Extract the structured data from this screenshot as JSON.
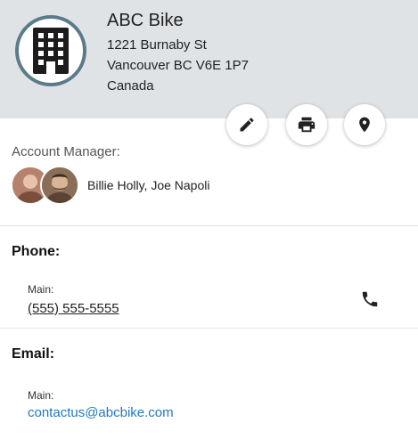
{
  "company": {
    "name": "ABC Bike",
    "address_line1": "1221 Burnaby St",
    "address_line2": "Vancouver BC V6E 1P7",
    "address_line3": "Canada",
    "icon": "building-icon"
  },
  "actions": {
    "edit_icon": "pencil-icon",
    "print_icon": "printer-icon",
    "map_icon": "map-pin-icon"
  },
  "account_manager": {
    "label": "Account Manager:",
    "names": "Billie Holly, Joe Napoli"
  },
  "phone": {
    "title": "Phone:",
    "sub_label": "Main:",
    "number": "(555) 555-5555",
    "call_icon": "phone-icon"
  },
  "email": {
    "title": "Email:",
    "sub_label": "Main:",
    "address": "contactus@abcbike.com"
  },
  "colors": {
    "header_bg": "#dfe3e6",
    "icon_ring": "#5b7b8a",
    "link": "#1f78c1"
  }
}
